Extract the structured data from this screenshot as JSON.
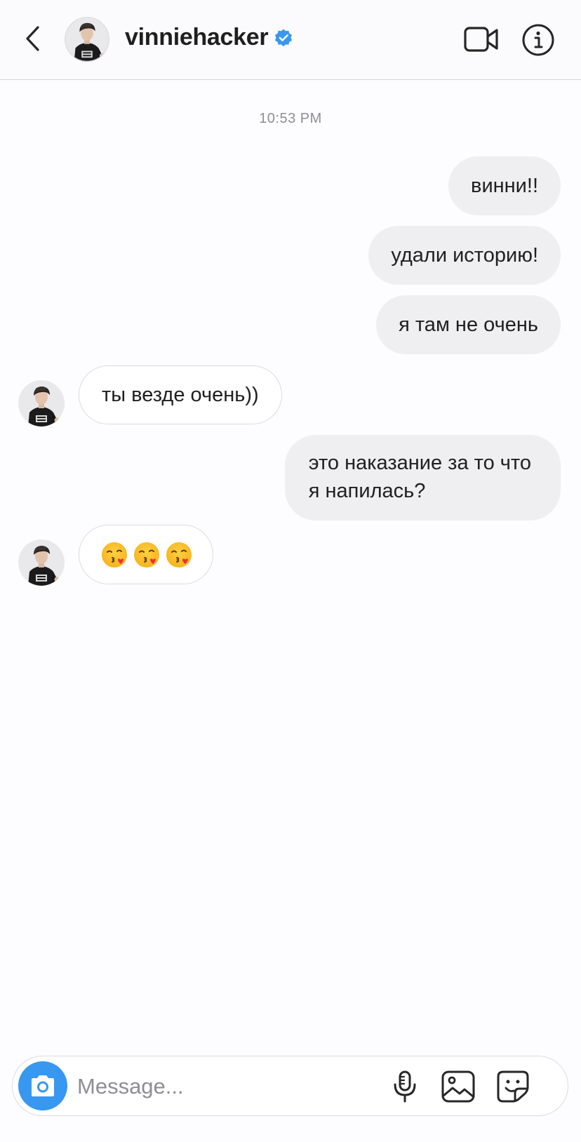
{
  "header": {
    "username": "vinniehacker",
    "verified": true,
    "icons": {
      "back": "chevron-left-icon",
      "verified": "verified-badge-icon",
      "video": "video-call-icon",
      "info": "info-icon"
    }
  },
  "chat": {
    "timestamp": "10:53 PM",
    "messages": [
      {
        "direction": "outgoing",
        "text": "винни!!"
      },
      {
        "direction": "outgoing",
        "text": "удали историю!"
      },
      {
        "direction": "outgoing",
        "text": "я там не очень"
      },
      {
        "direction": "incoming",
        "text": "ты везде очень))"
      },
      {
        "direction": "outgoing",
        "line1": "это наказание за то что",
        "line2": "я напилась?"
      },
      {
        "direction": "incoming",
        "emoji": [
          "face-blowing-kiss",
          "face-blowing-kiss",
          "face-blowing-kiss"
        ]
      }
    ]
  },
  "composer": {
    "placeholder": "Message...",
    "icons": {
      "camera": "camera-icon",
      "mic": "microphone-icon",
      "gallery": "gallery-icon",
      "sticker": "sticker-icon"
    }
  },
  "colors": {
    "accent": "#3897f0",
    "outgoing_bubble": "#efeef1",
    "incoming_border": "#dcdbe0",
    "timestamp": "#8e8e93"
  }
}
